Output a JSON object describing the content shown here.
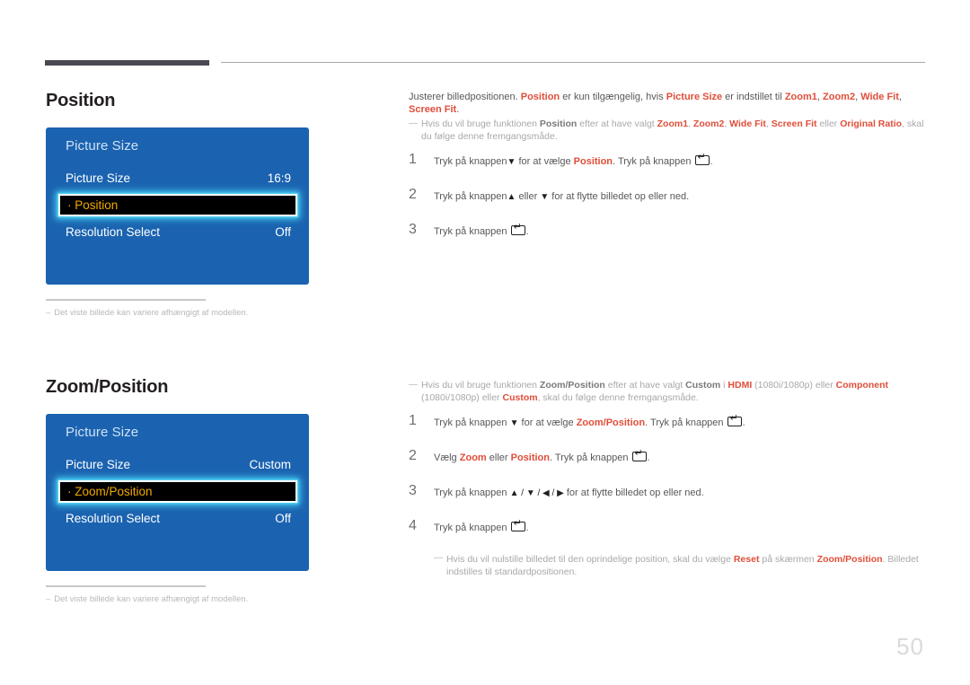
{
  "page": {
    "number": "50"
  },
  "sections": [
    {
      "title": "Position",
      "osd": {
        "header": "Picture Size",
        "rows": [
          {
            "label": "Picture Size",
            "value": "16:9"
          },
          {
            "label": "· Position",
            "value": "",
            "selected": true
          },
          {
            "label": "Resolution Select",
            "value": "Off"
          }
        ]
      },
      "footnote": {
        "dash": "–",
        "text": "Det viste billede kan variere afhængigt af modellen."
      },
      "intro": {
        "t1": "Justerer billedpositionen. ",
        "b1": "Position",
        "t2": " er kun tilgængelig, hvis ",
        "b2": "Picture Size",
        "t3": " er indstillet til ",
        "b3": "Zoom1",
        "t4": ", ",
        "b4": "Zoom2",
        "t5": ", ",
        "b5": "Wide Fit",
        "t6": ", ",
        "b6": "Screen Fit",
        "t7": "."
      },
      "note": {
        "t1": "Hvis du vil bruge funktionen ",
        "b1": "Position",
        "t2": " efter at have valgt ",
        "b2": "Zoom1",
        "t3": ", ",
        "b3": "Zoom2",
        "t4": ", ",
        "b4": "Wide Fit",
        "t5": ", ",
        "b5": "Screen Fit",
        "t6": " eller ",
        "b6": "Original Ratio",
        "t7": ", skal du følge denne fremgangsmåde."
      },
      "steps": [
        {
          "num": "1",
          "t1": "Tryk på knappen",
          "arrow1": "▼",
          "t2": " for at vælge ",
          "b1": "Position",
          "t3": ". Tryk på knappen ",
          "key": true,
          "t4": "."
        },
        {
          "num": "2",
          "t1": "Tryk på knappen",
          "arrow1": "▲",
          "t2": " eller ",
          "arrow2": "▼",
          "t3": " for at flytte billedet op eller ned.",
          "key": false,
          "t4": ""
        },
        {
          "num": "3",
          "t1": "Tryk på knappen",
          "arrow1": "",
          "t2": " ",
          "b1": "",
          "t3": "",
          "key": true,
          "t4": "."
        }
      ]
    },
    {
      "title": "Zoom/Position",
      "osd": {
        "header": "Picture Size",
        "rows": [
          {
            "label": "Picture Size",
            "value": "Custom"
          },
          {
            "label": "· Zoom/Position",
            "value": "",
            "selected": true
          },
          {
            "label": "Resolution Select",
            "value": "Off"
          }
        ]
      },
      "footnote": {
        "dash": "–",
        "text": "Det viste billede kan variere afhængigt af modellen."
      },
      "note": {
        "t1": "Hvis du vil bruge funktionen ",
        "b1": "Zoom/Position",
        "t2": " efter at have valgt ",
        "b2": "Custom",
        "t3": " i ",
        "b3": "HDMI",
        "t4": " (1080i/1080p) eller ",
        "b4": "Component",
        "t5": " (1080i/1080p) eller ",
        "b5": "Custom",
        "t6": ", skal du følge denne fremgangsmåde."
      },
      "steps": [
        {
          "num": "1",
          "t1": "Tryk på knappen ",
          "arrow1": "▼",
          "t2": " for at vælge ",
          "b1": "Zoom/Position",
          "t3": ". Tryk på knappen ",
          "key": true,
          "t4": "."
        },
        {
          "num": "2",
          "t1": "Vælg ",
          "b1": "Zoom",
          "t2": " eller ",
          "b2": "Position",
          "t3": ". Tryk på knappen ",
          "key": true,
          "t4": "."
        },
        {
          "num": "3",
          "t1": "Tryk på knappen ",
          "arrows": "▲ / ▼ / ◀ / ▶",
          "t2": " for at flytte billedet op eller ned.",
          "key": false,
          "t4": ""
        },
        {
          "num": "4",
          "t1": "Tryk på knappen ",
          "key": true,
          "t4": "."
        }
      ],
      "reset_note": {
        "t1": "Hvis du vil nulstille billedet til den oprindelige position, skal du vælge ",
        "b1": "Reset",
        "t2": " på skærmen ",
        "b2": "Zoom/Position",
        "t3": ". Billedet indstilles til standardpositionen."
      }
    }
  ]
}
